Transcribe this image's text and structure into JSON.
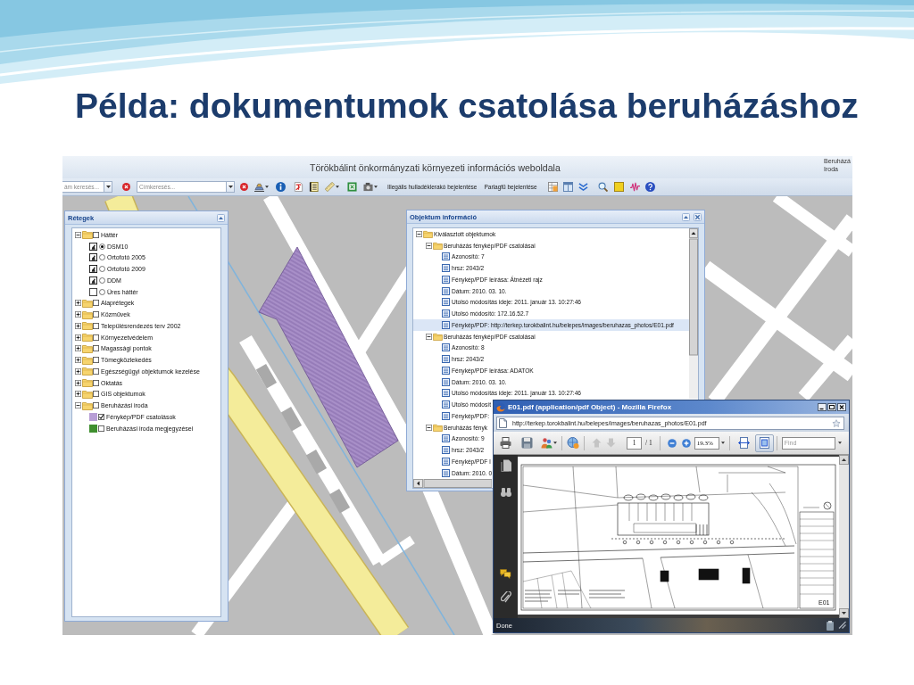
{
  "slide": {
    "title": "Példa: dokumentumok csatolása beruházáshoz"
  },
  "app": {
    "title": "Törökbálint önkormányzati környezeti információs weboldala",
    "user_lines": [
      "Beruházá",
      "Iroda"
    ]
  },
  "toolbar": {
    "address_search": {
      "placeholder": "ám keresés..."
    },
    "place_search": {
      "placeholder": "Címkeresés..."
    },
    "report_links": [
      "Illegális hulladéklerakó bejelentése",
      "Parlagfű bejelentése"
    ]
  },
  "layers_panel": {
    "title": "Rétegek",
    "tree": [
      {
        "label": "Háttér",
        "expanded": true,
        "checked": false,
        "children": [
          {
            "label": "DSM10",
            "kind": "raster",
            "selected": true
          },
          {
            "label": "Ortofotó 2005",
            "kind": "raster",
            "selected": false
          },
          {
            "label": "Ortofotó 2009",
            "kind": "raster",
            "selected": false
          },
          {
            "label": "DDM",
            "kind": "raster",
            "selected": false
          },
          {
            "label": "Üres háttér",
            "kind": "empty",
            "selected": false
          }
        ]
      },
      {
        "label": "Alaprétegek",
        "expanded": false,
        "checked": false
      },
      {
        "label": "Közművek",
        "expanded": false,
        "checked": false
      },
      {
        "label": "Településrendezés terv 2002",
        "expanded": false,
        "checked": false
      },
      {
        "label": "Környezetvédelem",
        "expanded": false,
        "checked": false
      },
      {
        "label": "Magassági pontok",
        "expanded": false,
        "checked": false
      },
      {
        "label": "Tömegközlekedés",
        "expanded": false,
        "checked": false
      },
      {
        "label": "Egészségügyi objektumok kezelése",
        "expanded": false,
        "checked": false
      },
      {
        "label": "Oktatás",
        "expanded": false,
        "checked": false
      },
      {
        "label": "GIS objektumok",
        "expanded": false,
        "checked": false
      },
      {
        "label": "Beruházási iroda",
        "expanded": true,
        "checked": false,
        "children": [
          {
            "label": "Fénykép/PDF csatolások",
            "kind": "vector",
            "checked": true,
            "color": "#b89ed6"
          },
          {
            "label": "Beruházási iroda megjegyzései",
            "kind": "vector",
            "checked": false,
            "color": "#3f8f2f"
          }
        ]
      }
    ]
  },
  "info_panel": {
    "title": "Objektum információ",
    "tree": [
      {
        "label": "Kiválasztott objektumok",
        "expanded": true,
        "selected": false,
        "children": [
          {
            "label": "Beruházás fénykép/PDF csatolásai",
            "expanded": true,
            "selected": false,
            "children": [
              {
                "label": "Azonosító: 7",
                "selected": false
              },
              {
                "label": "hrsz: 2043/2",
                "selected": false
              },
              {
                "label": "Fénykép/PDF leírása: Átnézeti rajz",
                "selected": false
              },
              {
                "label": "Dátum: 2010. 03. 10.",
                "selected": false
              },
              {
                "label": "Utolsó módosítás ideje: 2011. január 13. 10:27:46",
                "selected": false
              },
              {
                "label": "Utolsó módosító: 172.16.52.7",
                "selected": false
              },
              {
                "label": "Fénykép/PDF: http://terkep.torokbalint.hu/belepes/images/beruhazas_photos/E01.pdf",
                "selected": true
              }
            ]
          },
          {
            "label": "Beruházás fénykép/PDF csatolásai",
            "expanded": true,
            "selected": false,
            "children": [
              {
                "label": "Azonosító: 8",
                "selected": false
              },
              {
                "label": "hrsz: 2043/2",
                "selected": false
              },
              {
                "label": "Fénykép/PDF leírása: ADATOK",
                "selected": false
              },
              {
                "label": "Dátum: 2010. 03. 10.",
                "selected": false
              },
              {
                "label": "Utolsó módosítás ideje: 2011. január 13. 10:27:46",
                "selected": false
              },
              {
                "label": "Utolsó módosít",
                "selected": false
              },
              {
                "label": "Fénykép/PDF:",
                "selected": false
              }
            ]
          },
          {
            "label": "Beruházás fényk",
            "expanded": true,
            "selected": false,
            "children": [
              {
                "label": "Azonosító: 9",
                "selected": false
              },
              {
                "label": "hrsz: 2043/2",
                "selected": false
              },
              {
                "label": "Fénykép/PDF l",
                "selected": false
              },
              {
                "label": "Dátum: 2010. 0",
                "selected": false
              }
            ]
          }
        ]
      }
    ]
  },
  "browser": {
    "title": "E01.pdf (application/pdf Object) - Mozilla Firefox",
    "url": "http://terkep.torokbalint.hu/belepes/images/beruhazas_photos/E01.pdf",
    "pdf_toolbar": {
      "page_nav_disabled": true,
      "page": "1",
      "page_count": "/ 1",
      "zoom": "19.3%",
      "fit_buttons": [
        {
          "selected": false
        },
        {
          "selected": true
        }
      ],
      "find": {
        "placeholder": "Find"
      }
    },
    "document": {
      "sheet_number": "E01"
    },
    "status": "Done"
  }
}
